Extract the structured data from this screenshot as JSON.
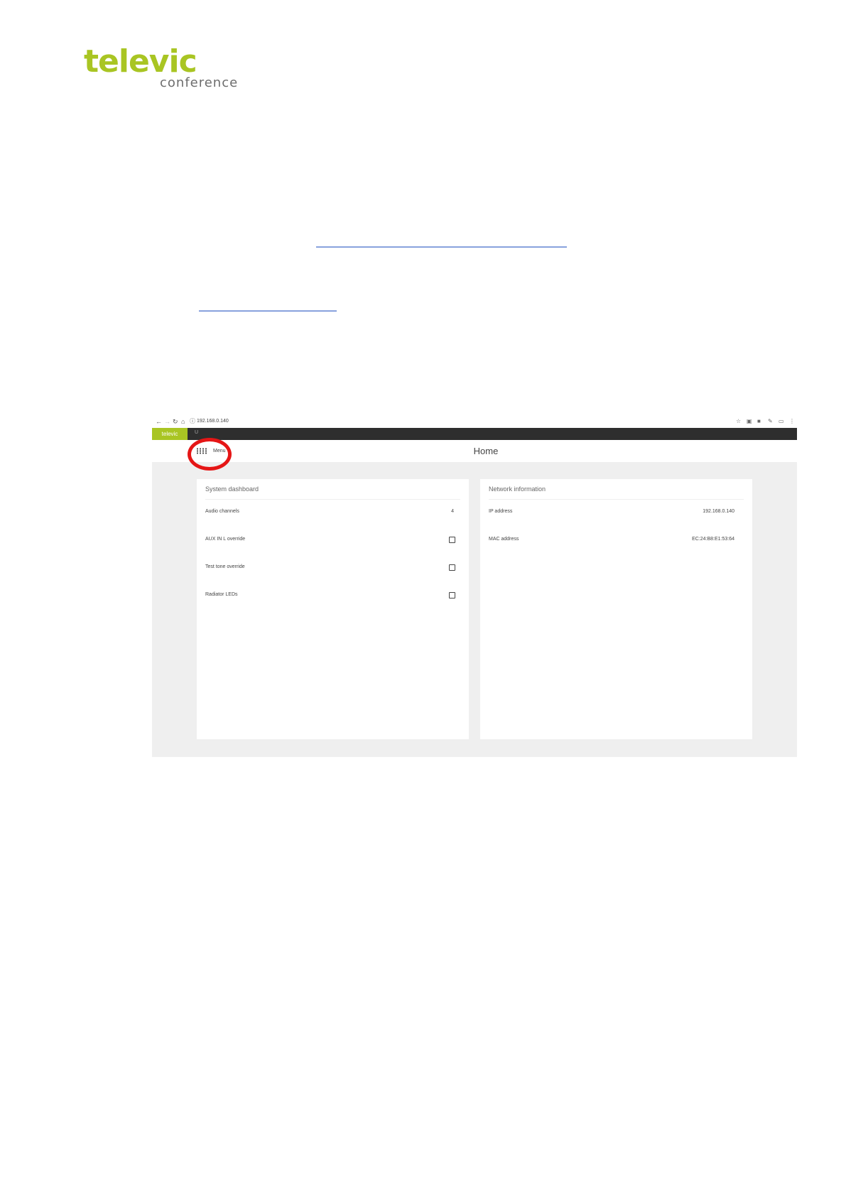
{
  "document": {
    "logo": {
      "brand": "televic",
      "sub": "conference"
    }
  },
  "browser": {
    "url": "192.168.0.140",
    "nav_icons": [
      "back-icon",
      "forward-icon",
      "reload-icon",
      "home-icon",
      "info-icon"
    ],
    "ext_icons": [
      "star-icon",
      "extension-icon",
      "extension-icon",
      "extension-icon",
      "cast-icon",
      "more-icon"
    ]
  },
  "app": {
    "brand": "televic",
    "crumb": "U",
    "menu_label": "Menu",
    "page_title": "Home",
    "highlight_color": "#e51616",
    "accent": "#a9c523",
    "system_dashboard": {
      "title": "System dashboard",
      "rows": [
        {
          "label": "Audio channels",
          "value": "4"
        },
        {
          "label": "AUX IN L override",
          "checked": false
        },
        {
          "label": "Test tone override",
          "checked": false
        },
        {
          "label": "Radiator LEDs",
          "checked": false
        }
      ]
    },
    "network_information": {
      "title": "Network information",
      "rows": [
        {
          "label": "IP address",
          "value": "192.168.0.140"
        },
        {
          "label": "MAC address",
          "value": "EC:24:B8:E1:53:64"
        }
      ]
    }
  }
}
